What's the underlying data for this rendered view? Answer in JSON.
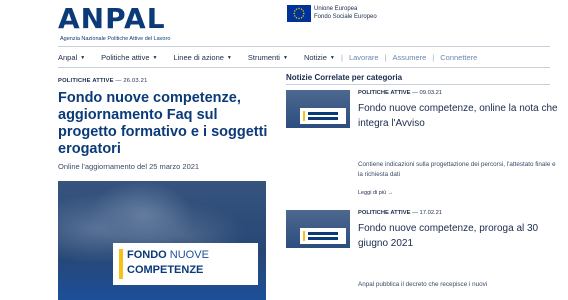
{
  "header": {
    "logo_text": "ANPAL",
    "logo_subtitle": "Agenzia Nazionale Politiche Attive del Lavoro",
    "eu_line1": "Unione Europea",
    "eu_line2": "Fondo Sociale Europeo"
  },
  "nav": {
    "items": [
      {
        "label": "Anpal"
      },
      {
        "label": "Politiche attive"
      },
      {
        "label": "Linee di azione"
      },
      {
        "label": "Strumenti"
      },
      {
        "label": "Notizie"
      }
    ],
    "right_links": [
      "Lavorare",
      "Assumere",
      "Connettere"
    ],
    "separator": "|"
  },
  "article": {
    "kicker": "POLITICHE ATTIVE",
    "date": "— 26.03.21",
    "title": "Fondo nuove competenze, aggiornamento Faq sul progetto formativo e i soggetti erogatori",
    "subtitle": "Online l'aggiornamento del 25 marzo 2021",
    "hero_line1_a": "FONDO",
    "hero_line1_b": "NUOVE",
    "hero_line2": "COMPETENZE"
  },
  "related": {
    "heading": "Notizie Correlate per categoria",
    "cards": [
      {
        "kicker": "POLITICHE ATTIVE",
        "date": "— 09.03.21",
        "title": "Fondo nuove competenze, online la nota che integra l'Avviso",
        "desc": "Contiene indicazioni sulla progettazione dei percorsi, l'attestato finale e la richiesta dati",
        "more": "Leggi di più →"
      },
      {
        "kicker": "POLITICHE ATTIVE",
        "date": "— 17.02.21",
        "title": "Fondo nuove competenze, proroga al 30 giugno 2021",
        "desc": "Anpal pubblica il decreto che recepisce i nuovi"
      }
    ]
  },
  "colors": {
    "primary": "#0b3a78",
    "accent": "#f4c21a",
    "link": "#6b87b1"
  }
}
